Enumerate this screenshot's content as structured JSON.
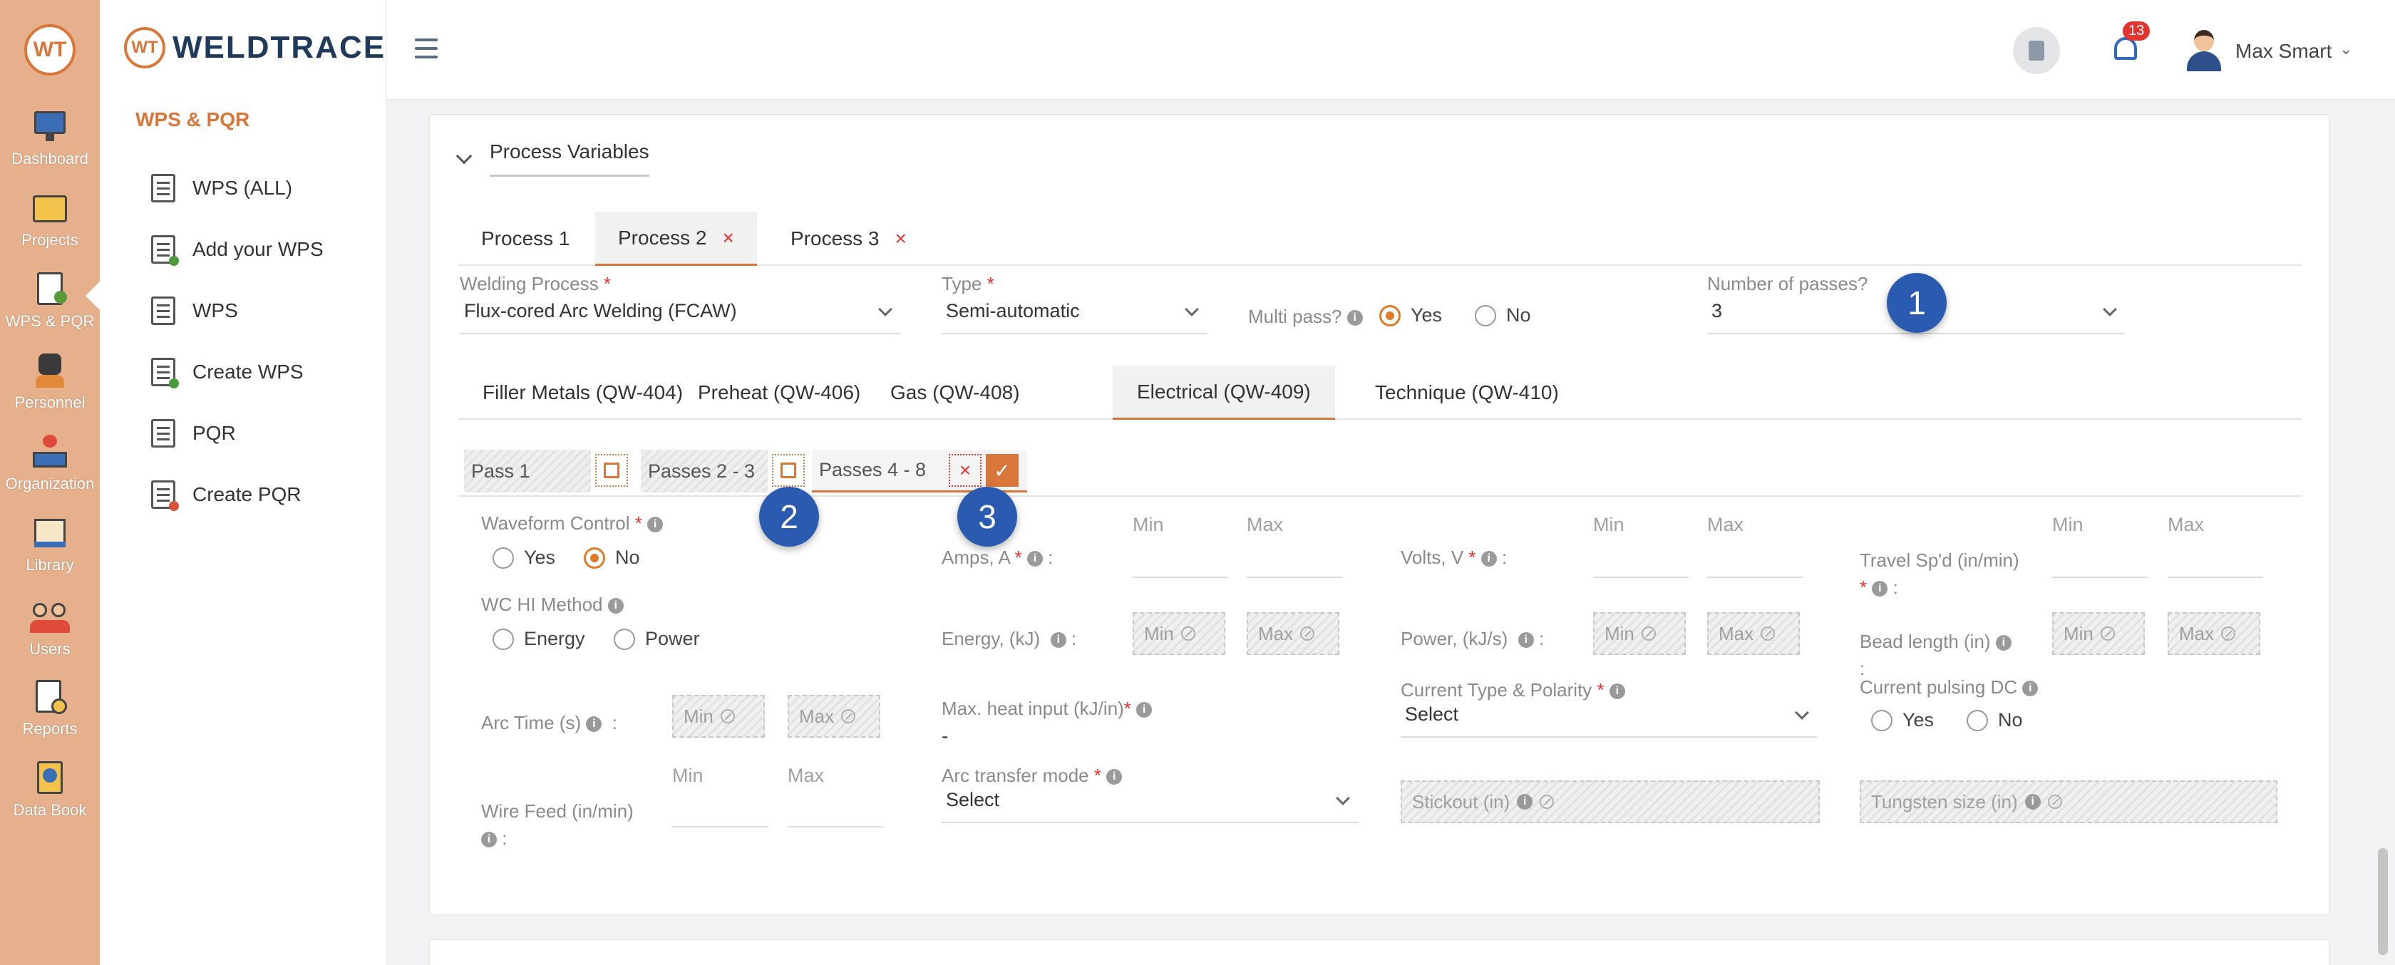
{
  "rail": {
    "logo": "WT",
    "items": [
      {
        "label": "Dashboard"
      },
      {
        "label": "Projects"
      },
      {
        "label": "WPS & PQR"
      },
      {
        "label": "Personnel"
      },
      {
        "label": "Organization"
      },
      {
        "label": "Library"
      },
      {
        "label": "Users"
      },
      {
        "label": "Reports"
      },
      {
        "label": "Data Book"
      }
    ]
  },
  "sidebar": {
    "brand_mark": "WT",
    "brand_name": "WELDTRACE",
    "section": "WPS & PQR",
    "items": [
      {
        "label": "WPS (ALL)"
      },
      {
        "label": "Add your WPS"
      },
      {
        "label": "WPS"
      },
      {
        "label": "Create WPS"
      },
      {
        "label": "PQR"
      },
      {
        "label": "Create PQR"
      }
    ]
  },
  "topbar": {
    "notifications": "13",
    "user_name": "Max Smart"
  },
  "card": {
    "title": "Process Variables",
    "process_tabs": [
      {
        "label": "Process 1"
      },
      {
        "label": "Process 2"
      },
      {
        "label": "Process 3"
      }
    ],
    "close_glyph": "×",
    "welding_process": {
      "label": "Welding Process",
      "value": "Flux-cored Arc Welding (FCAW)"
    },
    "type": {
      "label": "Type",
      "value": "Semi-automatic"
    },
    "multi_pass": {
      "label": "Multi pass?",
      "yes": "Yes",
      "no": "No"
    },
    "num_passes": {
      "label": "Number of passes?",
      "value": "3"
    },
    "req": "*",
    "section_tabs": [
      {
        "label": "Filler Metals (QW-404)"
      },
      {
        "label": "Preheat (QW-406)"
      },
      {
        "label": "Gas (QW-408)"
      },
      {
        "label": "Electrical (QW-409)"
      },
      {
        "label": "Technique (QW-410)"
      }
    ],
    "passes": [
      {
        "label": "Pass 1"
      },
      {
        "label": "Passes 2 - 3"
      },
      {
        "label": "Passes 4 - 8"
      }
    ],
    "callouts": [
      "1",
      "2",
      "3"
    ],
    "fields": {
      "waveform": {
        "label": "Waveform Control",
        "yes": "Yes",
        "no": "No"
      },
      "wc_hi": {
        "label": "WC HI Method",
        "energy": "Energy",
        "power": "Power"
      },
      "arc_time": {
        "label": "Arc Time (s)"
      },
      "wire_feed": {
        "label": "Wire Feed (in/min)"
      },
      "amps": {
        "label": "Amps, A"
      },
      "energy": {
        "label": "Energy, (kJ)"
      },
      "max_heat": {
        "label": "Max. heat input (kJ/in)",
        "value": "-"
      },
      "arc_transfer": {
        "label": "Arc transfer mode",
        "value": "Select"
      },
      "volts": {
        "label": "Volts, V"
      },
      "power": {
        "label": "Power, (kJ/s)"
      },
      "current_type": {
        "label": "Current Type & Polarity",
        "value": "Select"
      },
      "stickout": {
        "label": "Stickout (in)"
      },
      "travel": {
        "label": "Travel Sp'd (in/min)"
      },
      "bead": {
        "label": "Bead length (in)"
      },
      "pulsing": {
        "label": "Current pulsing DC",
        "yes": "Yes",
        "no": "No"
      },
      "tungsten": {
        "label": "Tungsten size (in)"
      }
    },
    "min": "Min",
    "max": "Max",
    "colon": ":"
  }
}
